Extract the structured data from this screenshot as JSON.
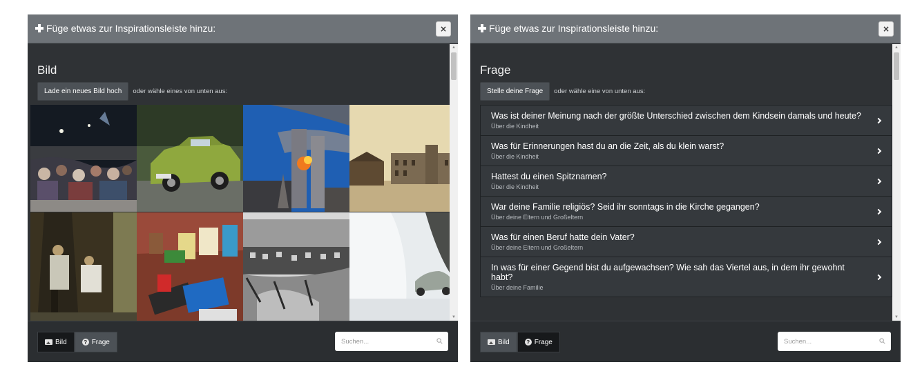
{
  "left_panel": {
    "header_title": "Füge etwas zur Inspirationsleiste hinzu:",
    "close_label": "×",
    "section_title": "Bild",
    "upload_button": "Lade ein neues Bild hoch",
    "hint": "oder wähle eines von unten aus:",
    "tabs": [
      {
        "label": "Bild",
        "icon": "image-icon",
        "active": true
      },
      {
        "label": "Frage",
        "icon": "question-icon",
        "active": false
      }
    ],
    "search": {
      "placeholder": "Suchen..."
    }
  },
  "right_panel": {
    "header_title": "Füge etwas zur Inspirationsleiste hinzu:",
    "close_label": "×",
    "section_title": "Frage",
    "ask_button": "Stelle deine Frage",
    "hint": "oder wähle eine von unten aus:",
    "questions": [
      {
        "text": "Was ist deiner Meinung nach der größte Unterschied zwischen dem Kindsein damals und heute?",
        "category": "Über die Kindheit"
      },
      {
        "text": "Was für Erinnerungen hast du an die Zeit, als du klein warst?",
        "category": "Über die Kindheit"
      },
      {
        "text": "Hattest du einen Spitznamen?",
        "category": "Über die Kindheit"
      },
      {
        "text": "War deine Familie religiös? Seid ihr sonntags in die Kirche gegangen?",
        "category": "Über deine Eltern und Großeltern"
      },
      {
        "text": "Was für einen Beruf hatte dein Vater?",
        "category": "Über deine Eltern und Großeltern"
      },
      {
        "text": "In was für einer Gegend bist du aufgewachsen? Wie sah das Viertel aus, in dem ihr gewohnt habt?",
        "category": "Über deine Familie"
      }
    ],
    "tabs": [
      {
        "label": "Bild",
        "icon": "image-icon",
        "active": false
      },
      {
        "label": "Frage",
        "icon": "question-icon",
        "active": true
      }
    ],
    "search": {
      "placeholder": "Suchen..."
    }
  },
  "colors": {
    "panel_bg": "#2f3235",
    "header_bg": "#6e7378",
    "tab_active": "#17191b"
  }
}
